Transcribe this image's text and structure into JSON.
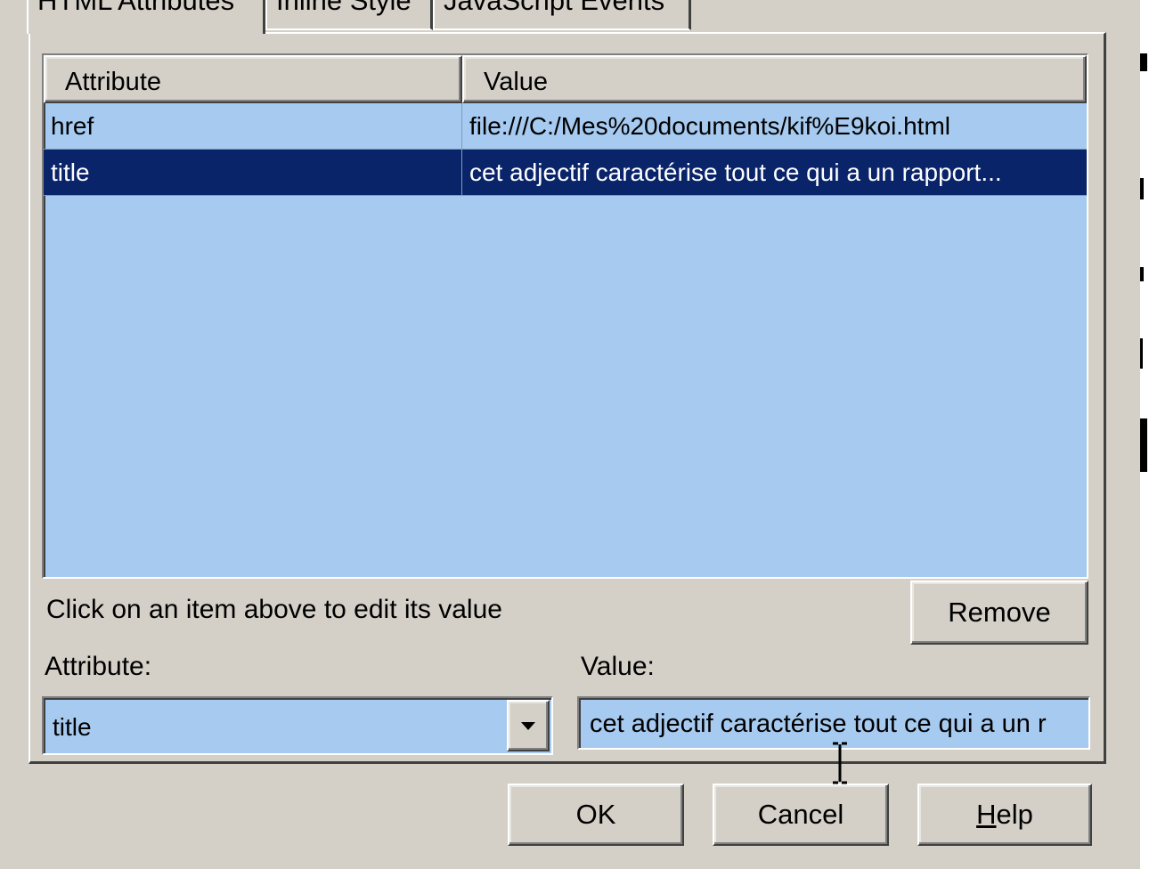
{
  "tabs": [
    {
      "label": "HTML Attributes",
      "active": true
    },
    {
      "label": "Inline Style",
      "active": false
    },
    {
      "label": "JavaScript Events",
      "active": false
    }
  ],
  "grid": {
    "columns": [
      "Attribute",
      "Value"
    ],
    "rows": [
      {
        "attribute": "href",
        "value": "file:///C:/Mes%20documents/kif%E9koi.html",
        "selected": false
      },
      {
        "attribute": "title",
        "value": "cet adjectif caractérise tout ce qui a un rapport...",
        "selected": true
      }
    ]
  },
  "hint_text": "Click on an item above to edit its value",
  "remove_label": "Remove",
  "attribute_label": "Attribute:",
  "attribute_value": "title",
  "value_label": "Value:",
  "value_text": "cet adjectif caractérise tout ce qui a un r",
  "buttons": {
    "ok": "OK",
    "cancel": "Cancel",
    "help": "Help",
    "help_mnemonic": "H",
    "help_rest": "elp"
  },
  "colors": {
    "grid_bg": "#a6caf0",
    "selected_bg": "#0a246a",
    "dialog_bg": "#d4d0c8"
  }
}
